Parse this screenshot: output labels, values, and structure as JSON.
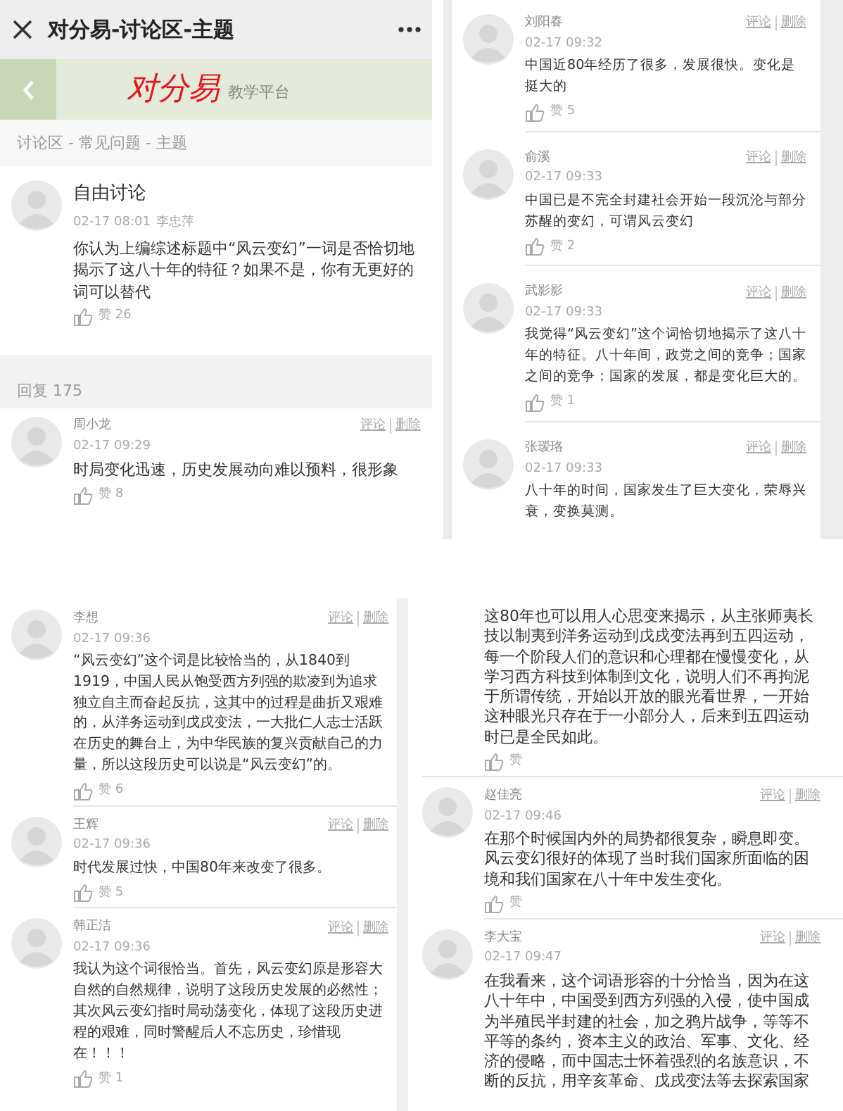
{
  "panels": [
    {
      "kind": "header",
      "title": "对分易-讨论区-主题",
      "logo": "对分易",
      "logo_subtitle": "教学平台",
      "breadcrumb": "讨论区 - 常见问题 - 主题",
      "topic": {
        "title": "自由讨论",
        "time": "02-17 08:01",
        "author": "李忠萍",
        "text": "你认为上编综述标题中“风云变幻”一词是否恰切地揭示了这八十年的特征？如果不是，你有无更好的词可以替代",
        "likes": "赞 26"
      },
      "reply_count": "回复 175",
      "comments": [
        {
          "kind": "full",
          "name": "周小龙",
          "time": "02-17 09:29",
          "actions": [
            "评论",
            "删除"
          ],
          "text": "时局变化迅速，历史发展动向难以预料，很形象",
          "likes": "赞 8"
        }
      ]
    },
    {
      "kind": "list",
      "comments": [
        {
          "kind": "full",
          "name": "刘阳春",
          "time": "02-17 09:32",
          "actions": [
            "评论",
            "删除"
          ],
          "text": "中国近80年经历了很多，发展很快。变化是挺大的",
          "likes": "赞 5"
        },
        {
          "kind": "full",
          "name": "俞溪",
          "time": "02-17 09:33",
          "actions": [
            "评论",
            "删除"
          ],
          "text": "中国已是不完全封建社会开始一段沉沦与部分苏醒的变幻，可谓风云变幻",
          "likes": "赞 2"
        },
        {
          "kind": "full",
          "name": "武影影",
          "time": "02-17 09:33",
          "actions": [
            "评论",
            "删除"
          ],
          "text": "我觉得“风云变幻”这个词恰切地揭示了这八十年的特征。八十年间，政党之间的竞争；国家之间的竞争；国家的发展，都是变化巨大的。",
          "likes": "赞 1"
        },
        {
          "kind": "full",
          "name": "张瑷珞",
          "time": "02-17 09:33",
          "actions": [
            "评论",
            "删除"
          ],
          "text": "八十年的时间，国家发生了巨大变化，荣辱兴衰，变换莫测。"
        }
      ]
    },
    {
      "kind": "list",
      "comments": [
        {
          "kind": "full",
          "name": "李想",
          "time": "02-17 09:36",
          "actions": [
            "评论",
            "删除"
          ],
          "text": "“风云变幻”这个词是比较恰当的，从1840到1919，中国人民从饱受西方列强的欺凌到为追求独立自主而奋起反抗，这其中的过程是曲折又艰难的，从洋务运动到戊戌变法，一大批仁人志士活跃在历史的舞台上，为中华民族的复兴贡献自己的力量，所以这段历史可以说是“风云变幻”的。",
          "likes": "赞 6"
        },
        {
          "kind": "full",
          "name": "王辉",
          "time": "02-17 09:36",
          "actions": [
            "评论",
            "删除"
          ],
          "text": "时代发展过快，中国80年来改变了很多。",
          "likes": "赞 5"
        },
        {
          "kind": "full",
          "name": "韩正洁",
          "time": "02-17 09:36",
          "actions": [
            "评论",
            "删除"
          ],
          "text": "我认为这个词很恰当。首先，风云变幻原是形容大自然的自然规律，说明了这段历史发展的必然性；其次风云变幻指时局动荡变化，体现了这段历史进程的艰难，同时警醒后人不忘历史，珍惜现在！！！",
          "likes": "赞 1"
        }
      ]
    },
    {
      "kind": "list",
      "comments": [
        {
          "kind": "continuation",
          "text": "这80年也可以用人心思变来揭示，从主张师夷长技以制夷到洋务运动到戊戌变法再到五四运动，每一个阶段人们的意识和心理都在慢慢变化，从学习西方科技到体制到文化，说明人们不再拘泥于所谓传统，开始以开放的眼光看世界，一开始这种眼光只存在于一小部分人，后来到五四运动时已是全民如此。",
          "likes": "赞"
        },
        {
          "kind": "full",
          "name": "赵佳亮",
          "time": "02-17 09:46",
          "actions": [
            "评论",
            "删除"
          ],
          "text": "在那个时候国内外的局势都很复杂，瞬息即变。风云变幻很好的体现了当时我们国家所面临的困境和我们国家在八十年中发生变化。",
          "likes": "赞"
        },
        {
          "kind": "full",
          "name": "李大宝",
          "time": "02-17 09:47",
          "actions": [
            "评论",
            "删除"
          ],
          "text": "在我看来，这个词语形容的十分恰当，因为在这八十年中，中国受到西方列强的入侵，使中国成为半殖民半封建的社会，加之鸦片战争，等等不平等的条约，资本主义的政治、军事、文化、经济的侵略，而中国志士怀着强烈的名族意识，不断的反抗，用辛亥革命、戊戌变法等去探索国家"
        }
      ]
    }
  ]
}
